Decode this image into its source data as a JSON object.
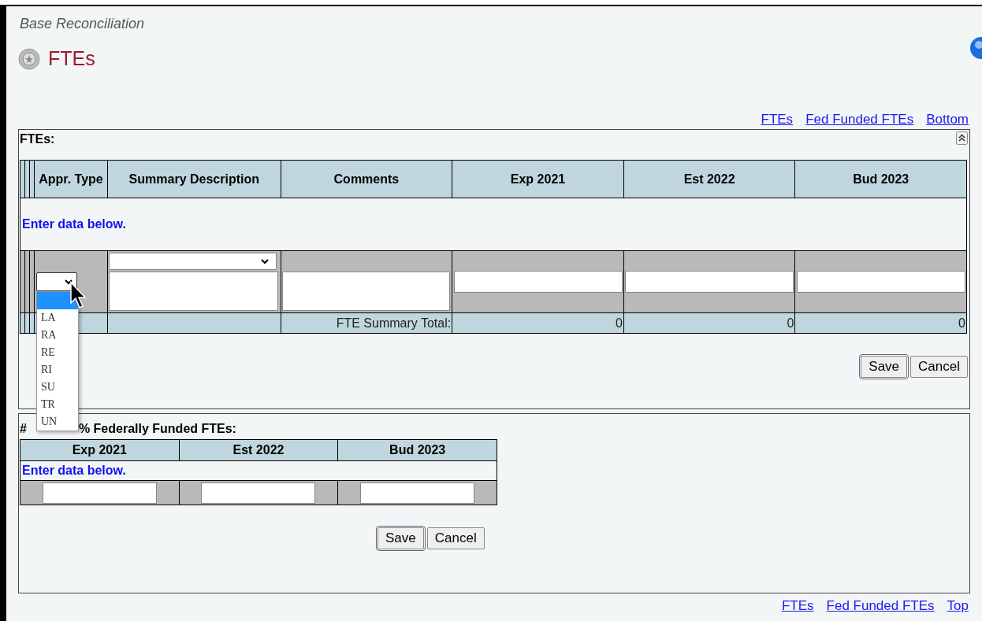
{
  "breadcrumb": "Base Reconciliation",
  "page_title": "FTEs",
  "top_links": [
    "FTEs",
    "Fed Funded FTEs",
    "Bottom"
  ],
  "fte_panel": {
    "title": "FTEs:",
    "columns": [
      "Appr. Type",
      "Summary Description",
      "Comments",
      "Exp 2021",
      "Est 2022",
      "Bud 2023"
    ],
    "hint": "Enter data below.",
    "total_label": "FTE Summary Total:",
    "totals": [
      "0",
      "0",
      "0"
    ],
    "buttons": [
      "Save",
      "Cancel"
    ]
  },
  "appr_type_dropdown": {
    "expanded": true,
    "blank_selected": true,
    "options": [
      {
        "label": "LA",
        "selected": false
      },
      {
        "label": "RA",
        "selected": false
      },
      {
        "label": "RE",
        "selected": false
      },
      {
        "label": "RI",
        "selected": false
      },
      {
        "label": "SU",
        "selected": false
      },
      {
        "label": "TR",
        "selected": false
      },
      {
        "label": "UN",
        "selected": false
      }
    ]
  },
  "fed_panel": {
    "title_start": "#",
    "title_end": "% Federally Funded FTEs:",
    "columns": [
      "Exp 2021",
      "Est 2022",
      "Bud 2023"
    ],
    "hint": "Enter data below.",
    "buttons": [
      "Save",
      "Cancel"
    ]
  },
  "bottom_links": [
    "FTEs",
    "Fed Funded FTEs",
    "Top"
  ]
}
